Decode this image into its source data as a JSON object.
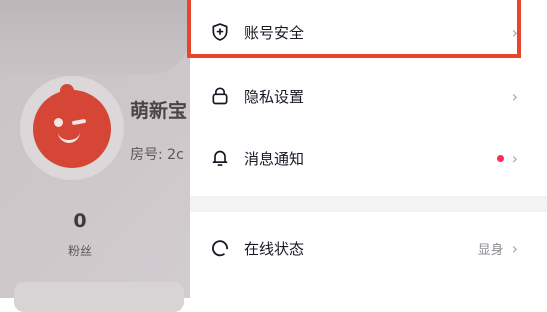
{
  "profile": {
    "name": "萌新宝",
    "room_label": "房号: 2c",
    "stats": [
      {
        "count": "0",
        "label": "粉丝"
      }
    ]
  },
  "drawer": {
    "items": [
      {
        "label": "账号安全",
        "icon": "shield-plus-icon",
        "status": "",
        "dot": false
      },
      {
        "label": "隐私设置",
        "icon": "lock-icon",
        "status": "",
        "dot": false
      },
      {
        "label": "消息通知",
        "icon": "bell-icon",
        "status": "",
        "dot": true
      },
      {
        "label": "在线状态",
        "icon": "online-status-icon",
        "status": "显身",
        "dot": false
      }
    ],
    "chevron": "›"
  },
  "colors": {
    "highlight": "#e8452f",
    "notification_dot": "#fe2c55",
    "avatar": "#d64637"
  }
}
